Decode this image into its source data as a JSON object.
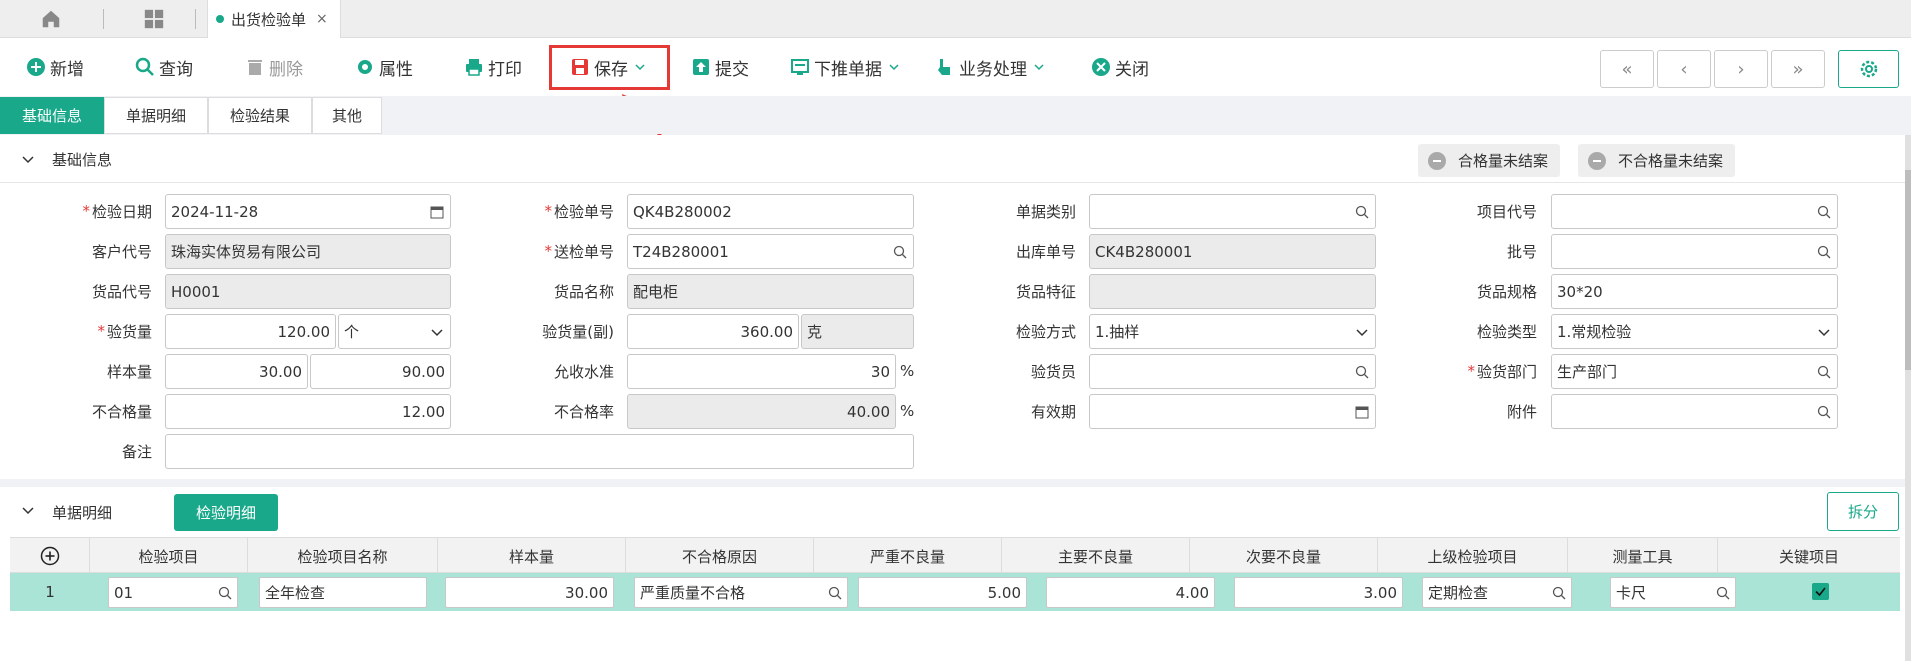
{
  "tabs": {
    "doc_title": "出货检验单",
    "close": "×"
  },
  "toolbar": {
    "add": "新增",
    "query": "查询",
    "delete": "删除",
    "props": "属性",
    "print": "打印",
    "save": "保存",
    "submit": "提交",
    "push_down": "下推单据",
    "business": "业务处理",
    "close": "关闭",
    "first": "«",
    "prev": "‹",
    "next": "›",
    "last": "»"
  },
  "section_tabs": [
    "基础信息",
    "单据明细",
    "检验结果",
    "其他"
  ],
  "base_panel": {
    "title": "基础信息",
    "pill1": "合格量未结案",
    "pill2": "不合格量未结案"
  },
  "form": {
    "inspect_date_label": "检验日期",
    "inspect_date": "2024-11-28",
    "inspect_no_label": "检验单号",
    "inspect_no": "QK4B280002",
    "doc_type_label": "单据类别",
    "doc_type": "",
    "project_code_label": "项目代号",
    "project_code": "",
    "customer_label": "客户代号",
    "customer": "珠海实体贸易有限公司",
    "send_no_label": "送检单号",
    "send_no": "T24B280001",
    "out_no_label": "出库单号",
    "out_no": "CK4B280001",
    "batch_label": "批号",
    "batch": "",
    "goods_code_label": "货品代号",
    "goods_code": "H0001",
    "goods_name_label": "货品名称",
    "goods_name": "配电柜",
    "goods_feature_label": "货品特征",
    "goods_feature": "",
    "goods_spec_label": "货品规格",
    "goods_spec": "30*20",
    "qty_label": "验货量",
    "qty": "120.00",
    "qty_unit": "个",
    "qty2_label": "验货量(副)",
    "qty2": "360.00",
    "qty2_unit": "克",
    "method_label": "检验方式",
    "method": "1.抽样",
    "type_label": "检验类型",
    "type": "1.常规检验",
    "sample_label": "样本量",
    "sample1": "30.00",
    "sample2": "90.00",
    "accept_label": "允收水准",
    "accept": "30",
    "accept_unit": "%",
    "inspector_label": "验货员",
    "inspector": "",
    "dept_label": "验货部门",
    "dept": "生产部门",
    "reject_label": "不合格量",
    "reject": "12.00",
    "reject_rate_label": "不合格率",
    "reject_rate": "40.00",
    "reject_rate_unit": "%",
    "expiry_label": "有效期",
    "expiry": "",
    "attach_label": "附件",
    "attach": "",
    "remark_label": "备注",
    "remark": ""
  },
  "detail_panel": {
    "title": "单据明细",
    "tab": "检验明细",
    "split": "拆分"
  },
  "grid": {
    "headers": [
      "检验项目",
      "检验项目名称",
      "样本量",
      "不合格原因",
      "严重不良量",
      "主要不良量",
      "次要不良量",
      "上级检验项目",
      "测量工具",
      "关键项目"
    ],
    "row": {
      "no": "1",
      "item": "01",
      "item_name": "全年检查",
      "sample": "30.00",
      "reason": "严重质量不合格",
      "critical": "5.00",
      "major": "4.00",
      "minor": "3.00",
      "parent": "定期检查",
      "tool": "卡尺",
      "key": true
    }
  },
  "colors": {
    "accent": "#19a88a",
    "highlight": "#e53935"
  }
}
